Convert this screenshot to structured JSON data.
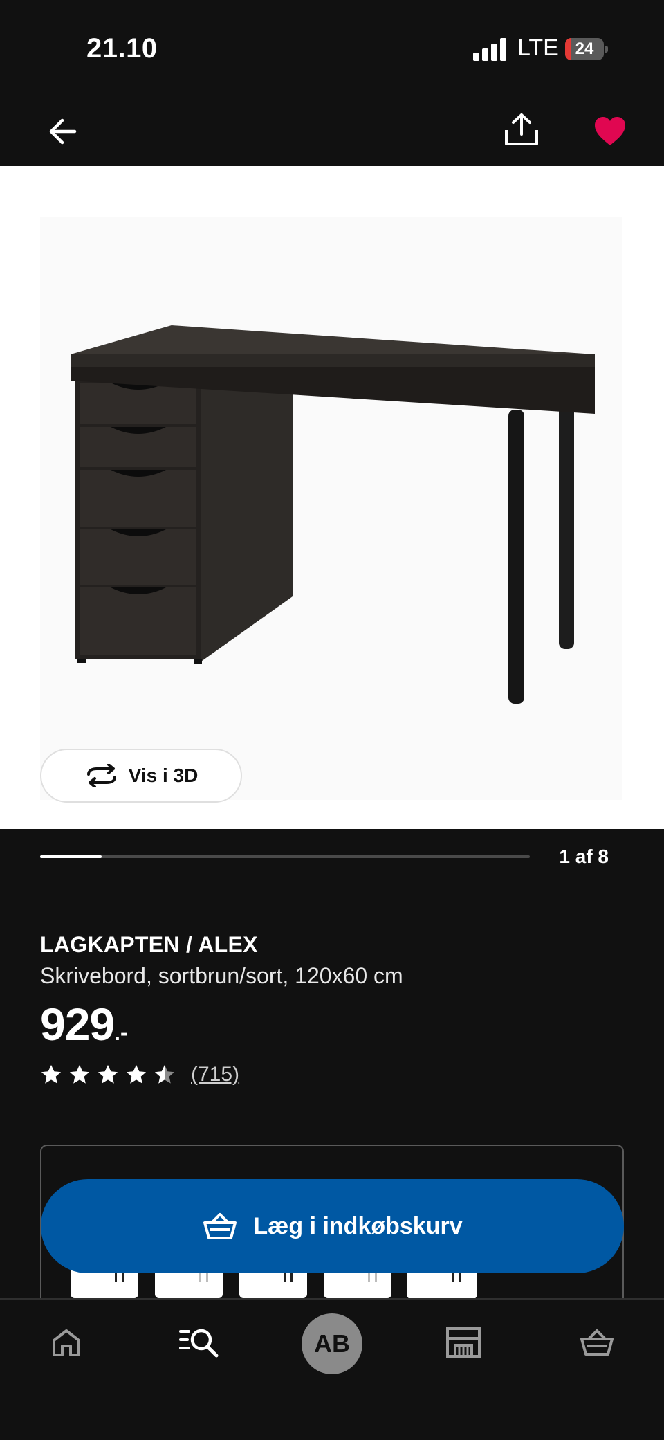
{
  "status_bar": {
    "time": "21.10",
    "network": "LTE",
    "battery": "24"
  },
  "header": {
    "back_icon": "arrow-left-icon",
    "share_icon": "share-icon",
    "favorite_icon": "heart-filled-icon",
    "favorite_color": "#e00751"
  },
  "gallery": {
    "view_3d_label": "Vis i 3D",
    "counter": "1 af 8",
    "current": 1,
    "total": 8
  },
  "product": {
    "name": "LAGKAPTEN / ALEX",
    "description": "Skrivebord, sortbrun/sort, 120x60 cm",
    "price": "929",
    "price_suffix": ".-",
    "rating": 4.5,
    "rating_max": 5,
    "review_count": "(715)"
  },
  "variant_thumbnails": [
    {
      "finish": "dark"
    },
    {
      "finish": "white"
    },
    {
      "finish": "dark"
    },
    {
      "finish": "white"
    },
    {
      "finish": "dark",
      "selected": true
    }
  ],
  "cart_button": {
    "label": "Læg i indkøbskurv",
    "icon": "shopping-basket-icon",
    "color": "#0058a3"
  },
  "tab_bar": {
    "home_icon": "home-icon",
    "search_icon": "search-list-icon",
    "profile_initials": "AB",
    "store_icon": "store-icon",
    "cart_icon": "shopping-basket-icon"
  },
  "colors": {
    "background": "#111111",
    "accent": "#0058a3",
    "favorite": "#e00751"
  }
}
